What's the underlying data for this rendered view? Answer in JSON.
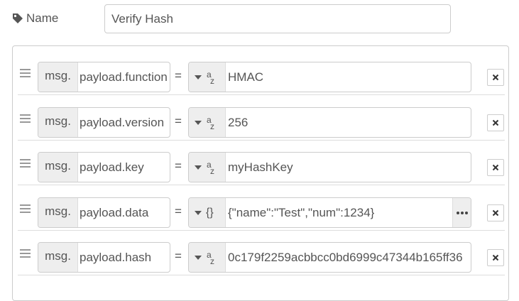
{
  "name_field": {
    "label": "Name",
    "value": "Verify Hash"
  },
  "rules": [
    {
      "prefix": "msg.",
      "property": "payload.function",
      "operator": "=",
      "type_icon": "az-string-icon",
      "value": "HMAC"
    },
    {
      "prefix": "msg.",
      "property": "payload.version",
      "operator": "=",
      "type_icon": "az-string-icon",
      "value": "256"
    },
    {
      "prefix": "msg.",
      "property": "payload.key",
      "operator": "=",
      "type_icon": "az-string-icon",
      "value": "myHashKey"
    },
    {
      "prefix": "msg.",
      "property": "payload.data",
      "operator": "=",
      "type_icon": "json-braces-icon",
      "type_symbol": "{}",
      "value": "{\"name\":\"Test\",\"num\":1234}"
    },
    {
      "prefix": "msg.",
      "property": "payload.hash",
      "operator": "=",
      "type_icon": "az-string-icon",
      "value": "0c179f2259acbbcc0bd6999c47344b165ff36"
    }
  ]
}
